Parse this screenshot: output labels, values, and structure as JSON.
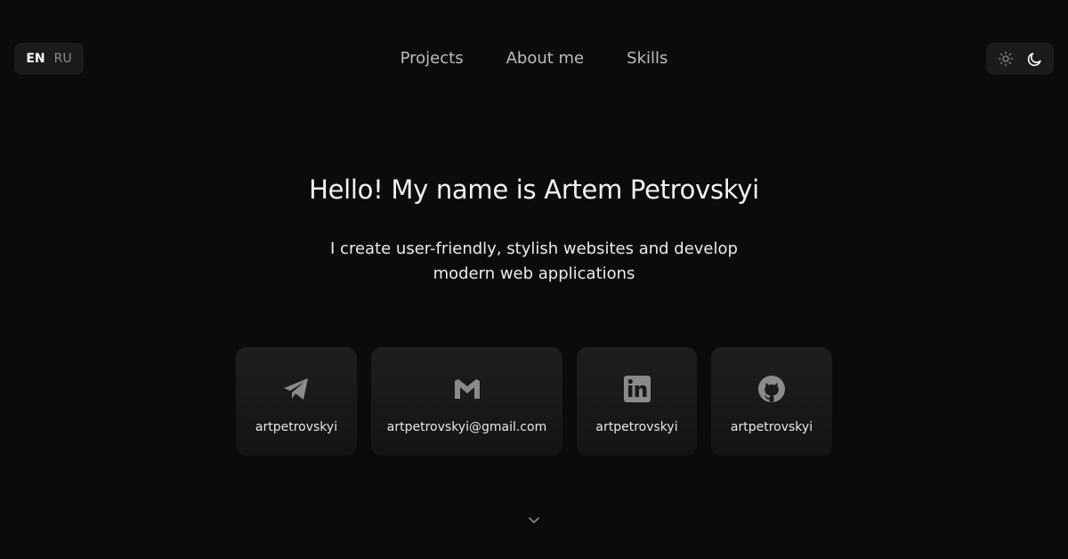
{
  "lang": {
    "active": "EN",
    "inactive": "RU"
  },
  "nav": {
    "items": [
      "Projects",
      "About me",
      "Skills"
    ]
  },
  "theme": {
    "light_icon": "sun-icon",
    "dark_icon": "moon-icon"
  },
  "hero": {
    "title": "Hello! My name is Artem Petrovskyi",
    "subtitle_line1": "I create user-friendly, stylish websites and develop",
    "subtitle_line2": "modern web applications"
  },
  "contacts": [
    {
      "icon": "telegram-icon",
      "label": "artpetrovskyi"
    },
    {
      "icon": "gmail-icon",
      "label": "artpetrovskyi@gmail.com"
    },
    {
      "icon": "linkedin-icon",
      "label": "artpetrovskyi"
    },
    {
      "icon": "github-icon",
      "label": "artpetrovskyi"
    }
  ],
  "scroll": {
    "icon": "chevron-down-icon"
  },
  "colors": {
    "background": "#0b0b0b",
    "card": "#1b1b1b",
    "icon": "#8a8a8a",
    "nav_text": "#bdbdbd"
  }
}
